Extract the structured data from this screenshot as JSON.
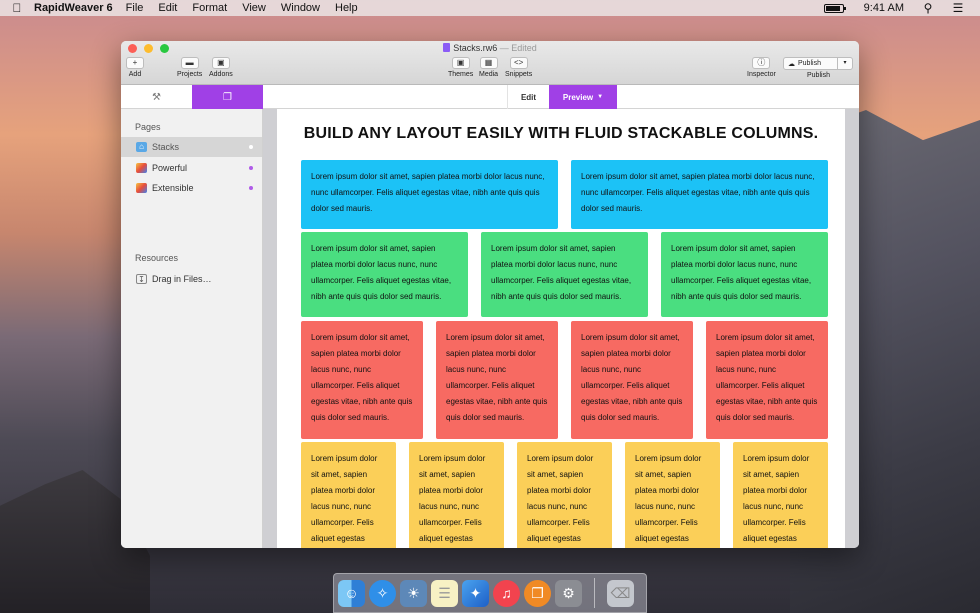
{
  "menubar": {
    "app_name": "RapidWeaver 6",
    "items": [
      "File",
      "Edit",
      "Format",
      "View",
      "Window",
      "Help"
    ],
    "time": "9:41 AM",
    "battery_level": 0.9
  },
  "window": {
    "doc_title": "Stacks.rw6",
    "doc_status": "Edited",
    "toolbar": {
      "add": "Add",
      "projects": "Projects",
      "addons": "Addons",
      "themes": "Themes",
      "media": "Media",
      "snippets": "Snippets",
      "inspector": "Inspector",
      "publish_button": "Publish",
      "publish_label": "Publish"
    },
    "tabs": {
      "edit": "Edit",
      "preview": "Preview"
    }
  },
  "sidebar": {
    "pages_heading": "Pages",
    "pages": [
      {
        "label": "Stacks",
        "dot_color": "#ffffff"
      },
      {
        "label": "Powerful",
        "dot_color": "#b05ce8"
      },
      {
        "label": "Extensible",
        "dot_color": "#b05ce8"
      }
    ],
    "resources_heading": "Resources",
    "resources_item": "Drag in Files…"
  },
  "content": {
    "heading": "BUILD ANY LAYOUT EASILY WITH FLUID STACKABLE COLUMNS.",
    "blue_text": "Lorem ipsum dolor sit amet, sapien platea morbi dolor lacus nunc, nunc ullamcorper. Felis aliquet egestas vitae, nibh ante quis quis dolor sed mauris.",
    "green_text": "Lorem ipsum dolor sit amet, sapien platea morbi dolor lacus nunc, nunc ullamcorper. Felis aliquet egestas vitae, nibh ante quis quis dolor sed mauris.",
    "red_text": "Lorem ipsum dolor sit amet, sapien platea morbi dolor lacus nunc, nunc ullamcorper. Felis aliquet egestas vitae, nibh ante quis quis dolor sed mauris.",
    "yellow_text": "Lorem ipsum dolor sit amet, sapien platea morbi dolor lacus nunc, nunc ullamcorper. Felis aliquet egestas vitae, nibh ante quis quis dolor sed mauris."
  },
  "colors": {
    "accent": "#a040e6",
    "blue": "#1cc2f6",
    "green": "#4ade80",
    "red": "#f76a62",
    "yellow": "#fbcf58"
  },
  "dock": [
    "finder-icon",
    "safari-icon",
    "preview-icon",
    "notes-icon",
    "rapidweaver-icon",
    "itunes-icon",
    "ibooks-icon",
    "system-preferences-icon",
    "trash-icon"
  ]
}
